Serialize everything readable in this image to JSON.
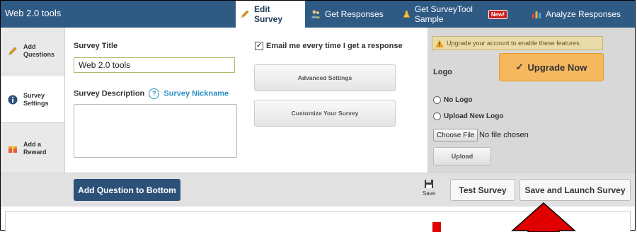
{
  "header": {
    "app_title": "Web 2.0 tools",
    "tabs": [
      {
        "label": "Edit Survey",
        "icon": "pencil-icon",
        "active": true
      },
      {
        "label": "Get Responses",
        "icon": "people-icon",
        "active": false
      },
      {
        "label": "Get SurveyTool Sample",
        "icon": "flask-icon",
        "badge": "New!",
        "active": false
      },
      {
        "label": "Analyze Responses",
        "icon": "bar-chart-icon",
        "active": false
      }
    ]
  },
  "sidebar": {
    "items": [
      {
        "label": "Add Questions",
        "icon": "pencil-icon",
        "active": false
      },
      {
        "label": "Survey Settings",
        "icon": "info-icon",
        "active": true
      },
      {
        "label": "Add a Reward",
        "icon": "gift-icon",
        "active": false
      }
    ]
  },
  "settings": {
    "title_label": "Survey Title",
    "title_value": "Web 2.0 tools",
    "description_label": "Survey Description",
    "nickname_link": "Survey Nickname",
    "email_checkbox_label": "Email me every time I get a response",
    "email_checked": true,
    "advanced_button": "Advanced Settings",
    "customize_button": "Customize Your Survey"
  },
  "upgrade_panel": {
    "notice": "Upgrade your account to enable these features.",
    "upgrade_button": "Upgrade Now",
    "logo_label": "Logo",
    "radio_no_logo": "No Logo",
    "radio_upload_logo": "Upload New Logo",
    "choose_file_button": "Choose File",
    "file_status": "No file chosen",
    "upload_button": "Upload"
  },
  "actions": {
    "add_question_button": "Add Question to Bottom",
    "save_label": "Save",
    "test_button": "Test Survey",
    "launch_button": "Save and Launch Survey"
  },
  "colors": {
    "nav_blue": "#2f5a84",
    "button_blue": "#2c5178",
    "upgrade_orange": "#f5b85f",
    "annotation_red": "#e00000"
  }
}
